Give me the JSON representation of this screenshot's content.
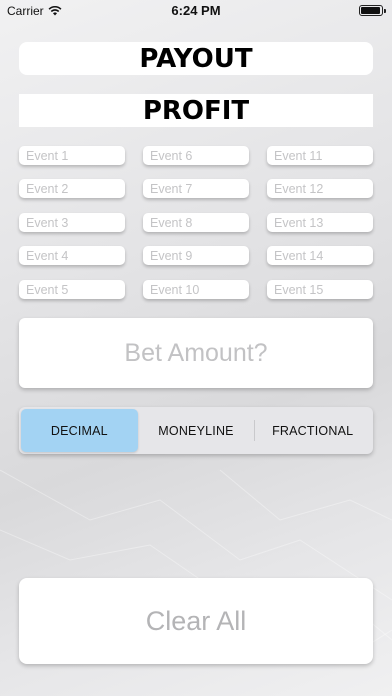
{
  "status_bar": {
    "carrier": "Carrier",
    "time": "6:24 PM",
    "wifi_icon": "wifi-icon",
    "battery_icon": "battery-icon"
  },
  "payout_label": "PAYOUT",
  "profit_label": "PROFIT",
  "events": {
    "col1": [
      "Event 1",
      "Event 2",
      "Event 3",
      "Event 4",
      "Event 5"
    ],
    "col2": [
      "Event 6",
      "Event 7",
      "Event 8",
      "Event 9",
      "Event 10"
    ],
    "col3": [
      "Event 11",
      "Event 12",
      "Event 13",
      "Event 14",
      "Event 15"
    ]
  },
  "bet_amount": {
    "placeholder": "Bet Amount?",
    "value": ""
  },
  "odds_format": {
    "options": [
      "DECIMAL",
      "MONEYLINE",
      "FRACTIONAL"
    ],
    "selected": "DECIMAL",
    "accent_color": "#a3d3f3"
  },
  "clear_label": "Clear All"
}
